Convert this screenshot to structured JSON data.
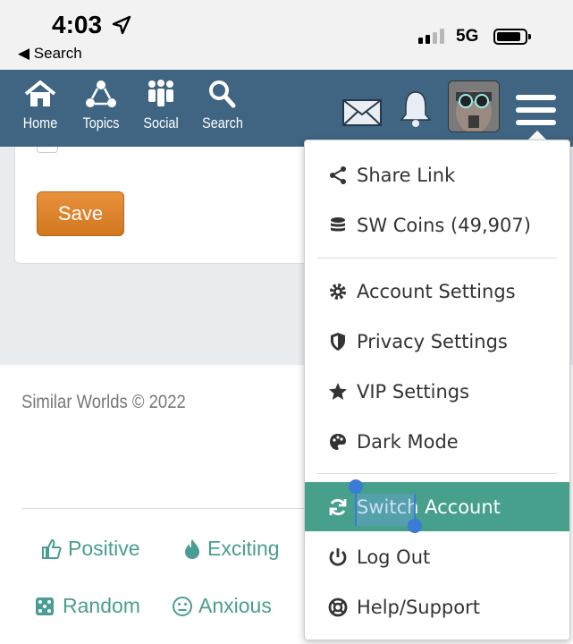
{
  "status": {
    "time": "4:03",
    "back": "◀ Search",
    "network": "5G"
  },
  "nav": {
    "items": [
      {
        "label": "Home"
      },
      {
        "label": "Topics"
      },
      {
        "label": "Social"
      },
      {
        "label": "Search"
      }
    ]
  },
  "card": {
    "save_label": "Save"
  },
  "footer": {
    "copyright": "Similar Worlds © 2022",
    "links": [
      "Positive",
      "Exciting",
      "Random",
      "Anxious"
    ]
  },
  "menu": {
    "items": [
      {
        "label": "Share Link",
        "icon": "share-icon"
      },
      {
        "label": "SW Coins (49,907)",
        "icon": "coins-icon"
      },
      {
        "label": "Account Settings",
        "icon": "gear-icon"
      },
      {
        "label": "Privacy Settings",
        "icon": "shield-icon"
      },
      {
        "label": "VIP Settings",
        "icon": "star-icon"
      },
      {
        "label": "Dark Mode",
        "icon": "palette-icon"
      },
      {
        "label": "Switch Account",
        "icon": "sync-icon"
      },
      {
        "label": "Log Out",
        "icon": "power-icon"
      },
      {
        "label": "Help/Support",
        "icon": "lifebuoy-icon"
      }
    ]
  },
  "colors": {
    "nav": "#3f6583",
    "accent": "#47a08c",
    "save": "#e08630",
    "link": "#4a9d92"
  }
}
